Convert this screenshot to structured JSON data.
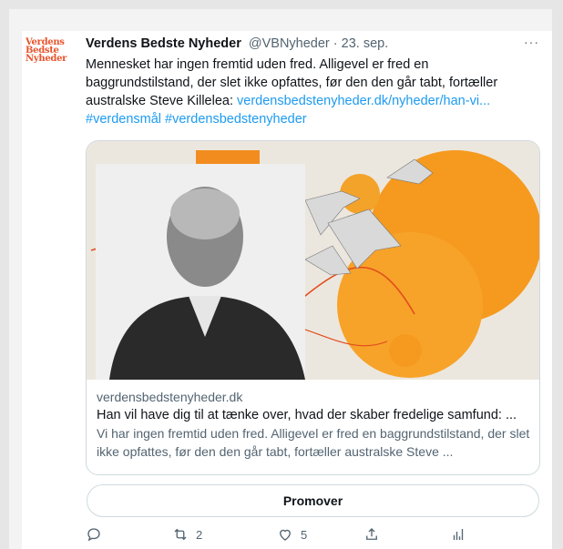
{
  "tweet": {
    "account": {
      "logo_lines": [
        "Verdens",
        "Bedste",
        "Nyheder"
      ],
      "name": "Verdens Bedste Nyheder",
      "handle": "@VBNyheder",
      "separator": "·",
      "date": "23. sep."
    },
    "more": "···",
    "text_part1": "Mennesket har ingen fremtid uden fred. Alligevel er fred en baggrundstilstand, der slet ikke opfattes, før den den går tabt, fortæller australske Steve Killelea: ",
    "link": "verdensbedstenyheder.dk/nyheder/han-vi...",
    "hashtags": "#verdensmål #verdensbedstenyheder"
  },
  "card": {
    "domain": "verdensbedstenyheder.dk",
    "title": "Han vil have dig til at tænke over, hvad der skaber fredelige samfund: ...",
    "description": "Vi har ingen fremtid uden fred. Alligevel er fred en baggrundstilstand, der slet ikke opfattes, før den den går tabt, fortæller australske Steve ..."
  },
  "promote_label": "Promover",
  "actions": {
    "reply_count": "",
    "retweet_count": "2",
    "like_count": "5"
  },
  "colors": {
    "accent_blue": "#1d9bf0",
    "orange": "#f28c1e",
    "logo_red": "#e8532c"
  }
}
